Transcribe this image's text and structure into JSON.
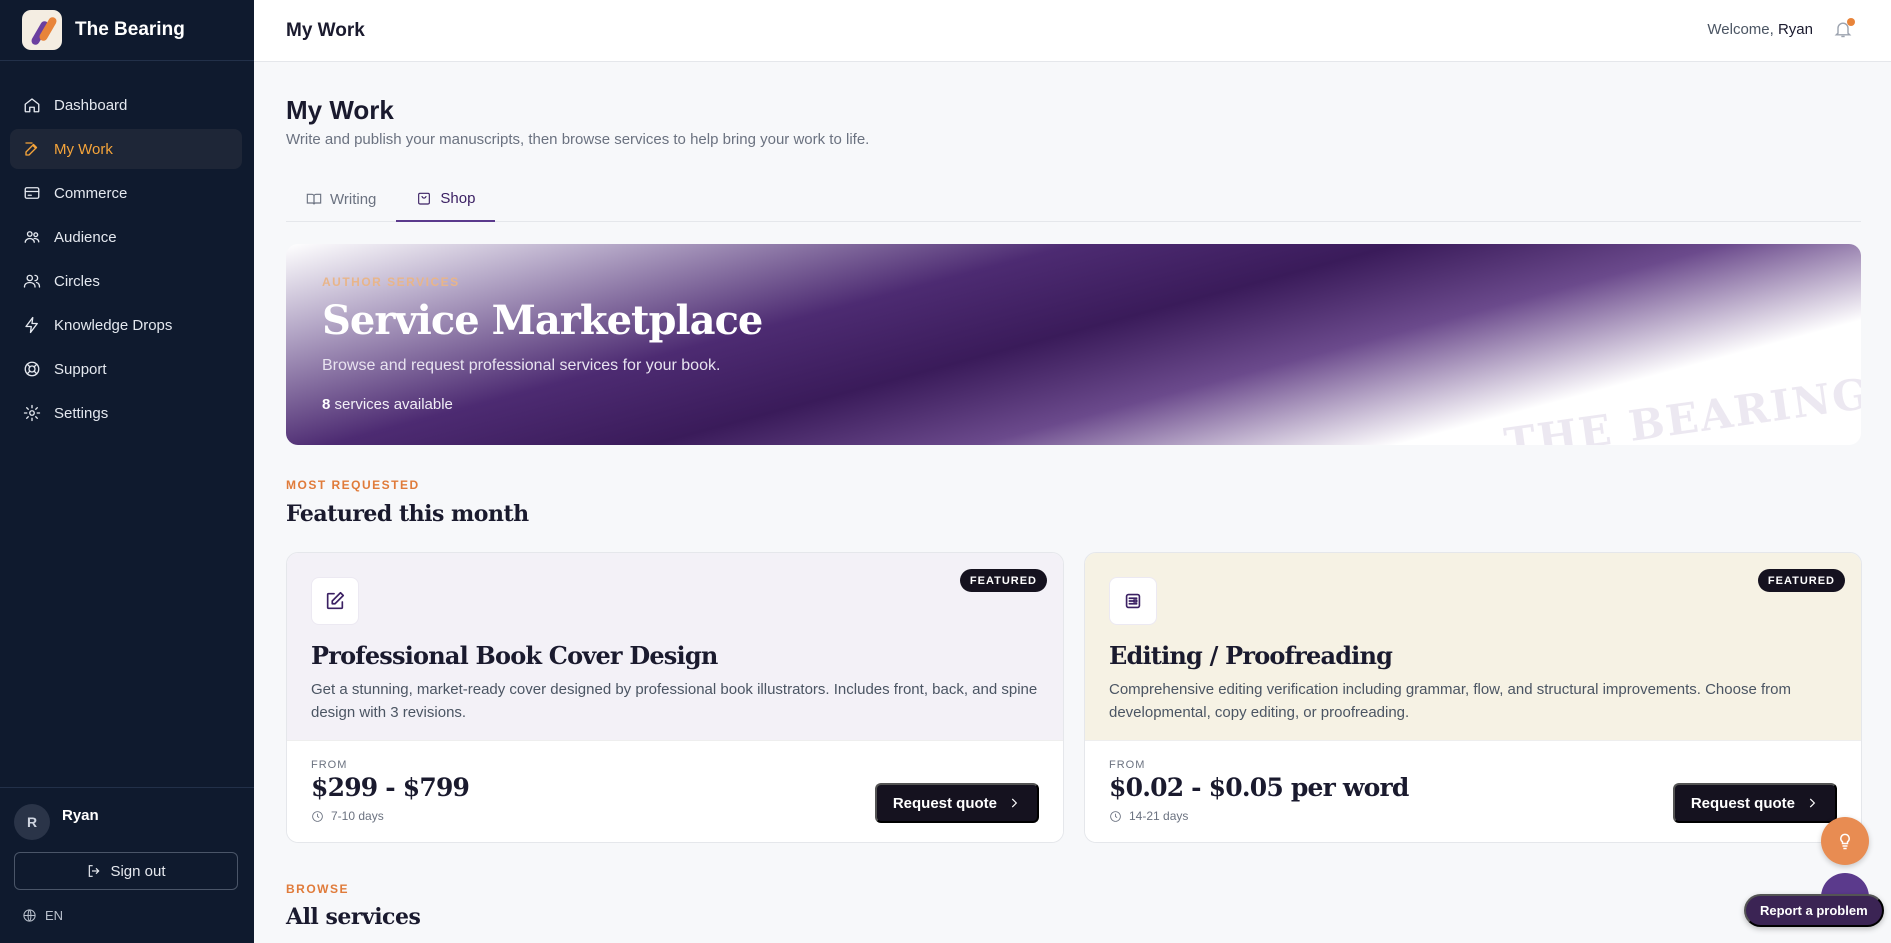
{
  "brand": {
    "name": "The Bearing"
  },
  "sidebar": {
    "items": [
      {
        "label": "Dashboard",
        "icon": "home-icon"
      },
      {
        "label": "My Work",
        "icon": "edit-icon",
        "active": true
      },
      {
        "label": "Commerce",
        "icon": "card-icon"
      },
      {
        "label": "Audience",
        "icon": "users-icon"
      },
      {
        "label": "Circles",
        "icon": "user-group-icon"
      },
      {
        "label": "Knowledge Drops",
        "icon": "lightning-icon"
      },
      {
        "label": "Support",
        "icon": "lifebuoy-icon"
      },
      {
        "label": "Settings",
        "icon": "gear-icon"
      }
    ],
    "user": {
      "initial": "R",
      "name": "Ryan"
    },
    "signout_label": "Sign out",
    "language": "EN"
  },
  "topbar": {
    "title": "My Work",
    "welcome_prefix": "Welcome, ",
    "welcome_name": "Ryan"
  },
  "page": {
    "title": "My Work",
    "subtitle": "Write and publish your manuscripts, then browse services to help bring your work to life."
  },
  "tabs": [
    {
      "label": "Writing",
      "icon": "book-icon"
    },
    {
      "label": "Shop",
      "icon": "shopping-bag-icon",
      "active": true
    }
  ],
  "hero": {
    "eyebrow": "AUTHOR SERVICES",
    "title": "Service Marketplace",
    "subtitle": "Browse and request professional services for your book.",
    "count": "8",
    "count_suffix": " services available",
    "watermark": "THE BEARING"
  },
  "featured": {
    "eyebrow": "MOST REQUESTED",
    "title": "Featured this month",
    "cards": [
      {
        "badge": "FEATURED",
        "icon": "pencil-square-icon",
        "title": "Professional Book Cover Design",
        "description": "Get a stunning, market-ready cover designed by professional book illustrators. Includes front, back, and spine design with 3 revisions.",
        "from_label": "FROM",
        "price": "$299 - $799",
        "duration": "7-10 days",
        "button": "Request quote",
        "tint": "#f3f1f7"
      },
      {
        "badge": "FEATURED",
        "icon": "newspaper-icon",
        "title": "Editing / Proofreading",
        "description": "Comprehensive editing verification including grammar, flow, and structural improvements. Choose from developmental, copy editing, or proofreading.",
        "from_label": "FROM",
        "price": "$0.02 - $0.05 per word",
        "duration": "14-21 days",
        "button": "Request quote",
        "tint": "#f6f2e4"
      }
    ]
  },
  "browse": {
    "eyebrow": "BROWSE",
    "title": "All services"
  },
  "floating": {
    "report_label": "Report a problem"
  }
}
